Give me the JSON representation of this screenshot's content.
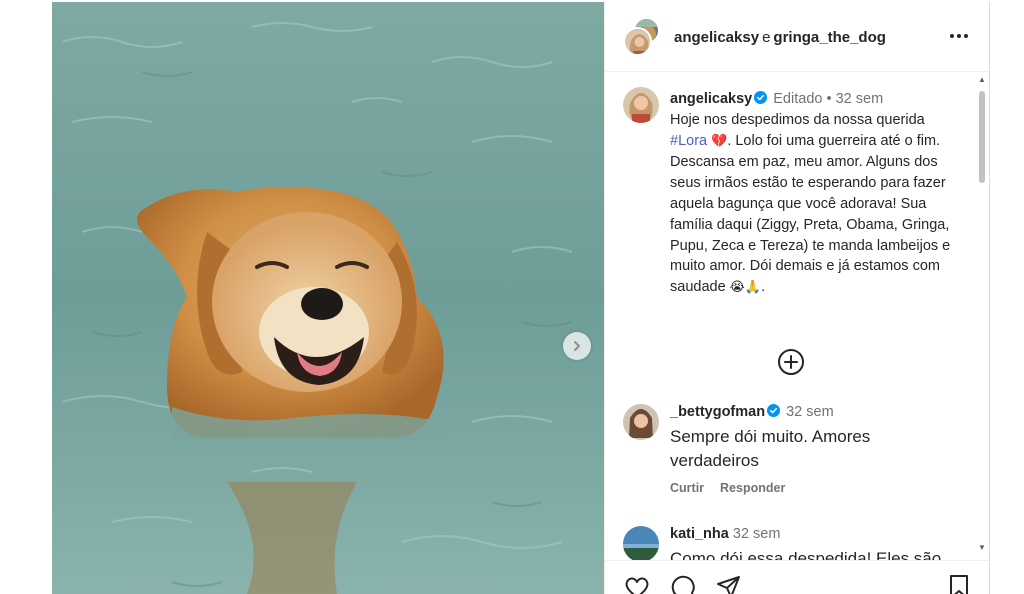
{
  "post": {
    "header": {
      "user1": "angelicaksy",
      "conjunction": "e",
      "user2": "gringa_the_dog"
    },
    "caption": {
      "username": "angelicaksy",
      "edited": "Editado",
      "dot": "•",
      "time": "32 sem",
      "text_before": "Hoje nos despedimos da nossa querida",
      "hashtag": "#Lora",
      "emoji_heart": "💔",
      "text_after": ". Lolo foi uma guerreira até o fim. Descansa em paz, meu amor. Alguns dos seus irmãos estão te esperando para fazer aquela bagunça que você adorava! Sua família daqui (Ziggy, Preta, Obama, Gringa, Pupu, Zeca e Tereza) te manda lambeijos e muito amor. Dói demais e já estamos com saudade",
      "emoji_end": "😭🙏",
      "period": "."
    },
    "comments": [
      {
        "username": "_bettygofman",
        "verified": true,
        "time": "32 sem",
        "text": "Sempre dói muito. Amores verdadeiros",
        "reply_to": "Curtir",
        "reply": "Responder"
      },
      {
        "username": "kati_nha",
        "verified": false,
        "time": "32 sem",
        "text": "Como dói essa despedida! Eles são"
      }
    ]
  },
  "icons": {
    "more": "more-options-icon",
    "next": "chevron-right-icon",
    "load_more": "plus-circle-icon",
    "like": "heart-icon",
    "comment": "comment-icon",
    "share": "send-icon",
    "save": "bookmark-icon",
    "verified": "verified-badge-icon"
  },
  "colors": {
    "hashtag": "#4f5fc5",
    "verified": "#0095f6",
    "meta": "#737373",
    "water": "#6f9f99",
    "dog": "#c98a3e"
  }
}
